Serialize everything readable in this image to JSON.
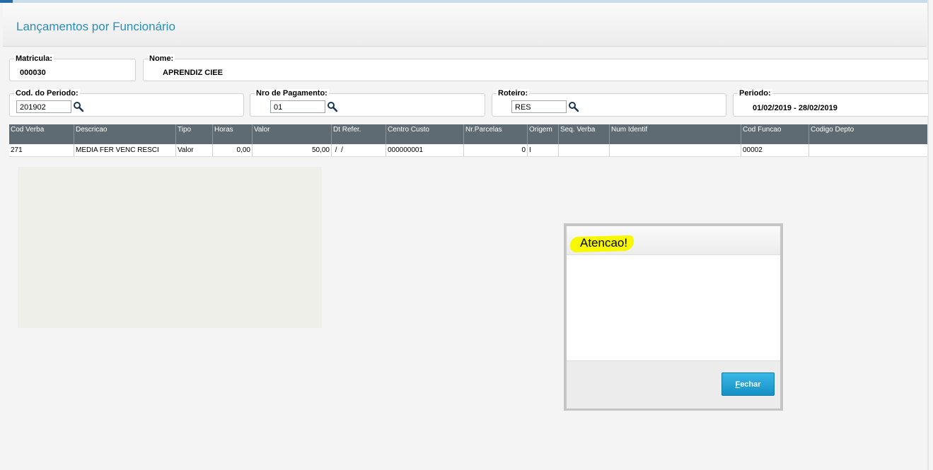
{
  "page": {
    "title": "Lançamentos por Funcionário"
  },
  "fields": {
    "matricula": {
      "label": "Matricula:",
      "value": "000030"
    },
    "nome": {
      "label": "Nome:",
      "value": "APRENDIZ CIEE"
    },
    "cod_periodo": {
      "label": "Cod. do Periodo:",
      "value": "201902"
    },
    "nro_pagamento": {
      "label": "Nro de Pagamento:",
      "value": "01"
    },
    "roteiro": {
      "label": "Roteiro:",
      "value": "RES"
    },
    "periodo": {
      "label": "Periodo:",
      "value": "01/02/2019 - 28/02/2019"
    }
  },
  "grid": {
    "columns": [
      "Cod Verba",
      "Descricao",
      "Tipo",
      "Horas",
      "Valor",
      "Dt Refer.",
      "Centro Custo",
      "Nr.Parcelas",
      "Origem",
      "Seq. Verba",
      "Num Identif",
      "Cod Funcao",
      "Codigo Depto"
    ],
    "rows": [
      [
        "271",
        "MEDIA FER VENC RESCI",
        "Valor",
        "0,00",
        "50,00",
        " /  /",
        "000000001",
        "0",
        "I",
        "",
        "",
        "00002",
        ""
      ]
    ]
  },
  "dialog": {
    "title": "Atencao!",
    "button_first": "F",
    "button_rest": "echar",
    "highlight_color": "#f8f800"
  },
  "icons": {
    "lookup": "magnifier-icon"
  }
}
